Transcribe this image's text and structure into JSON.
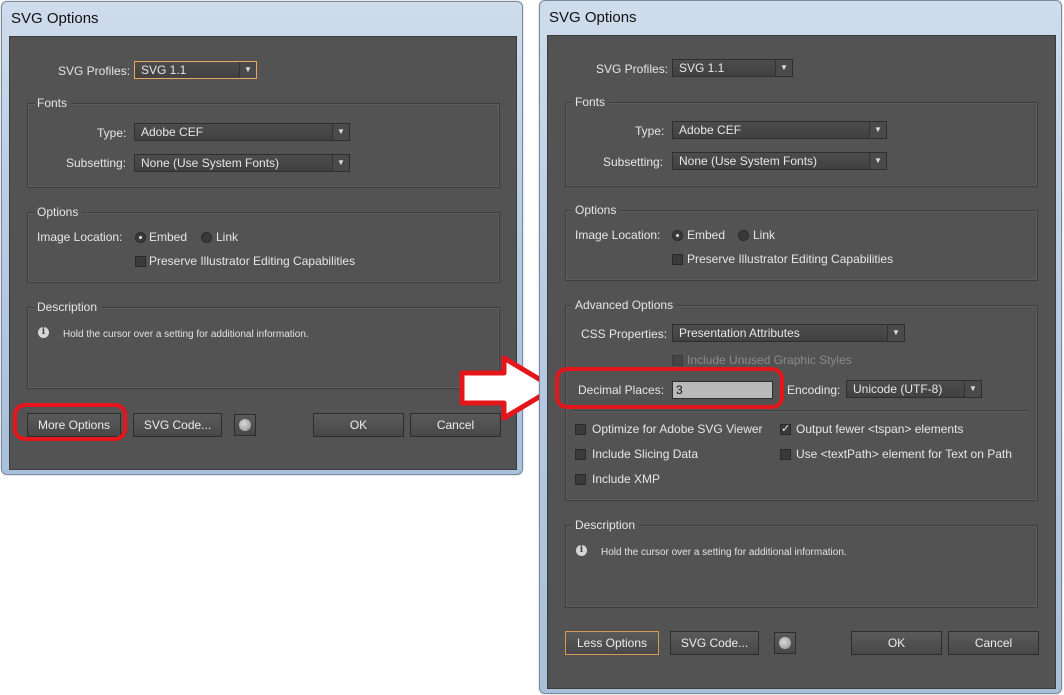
{
  "left": {
    "title": "SVG Options",
    "svg_profiles_label": "SVG Profiles:",
    "svg_profile_value": "SVG 1.1",
    "fonts_title": "Fonts",
    "type_label": "Type:",
    "type_value": "Adobe CEF",
    "subsetting_label": "Subsetting:",
    "subsetting_value": "None (Use System Fonts)",
    "options_title": "Options",
    "image_location_label": "Image Location:",
    "embed_label": "Embed",
    "link_label": "Link",
    "preserve_label": "Preserve Illustrator Editing Capabilities",
    "description_title": "Description",
    "description_text": "Hold the cursor over a setting for additional information.",
    "more_options_label": "More Options",
    "svg_code_label": "SVG Code...",
    "ok_label": "OK",
    "cancel_label": "Cancel"
  },
  "right": {
    "title": "SVG Options",
    "svg_profiles_label": "SVG Profiles:",
    "svg_profile_value": "SVG 1.1",
    "fonts_title": "Fonts",
    "type_label": "Type:",
    "type_value": "Adobe CEF",
    "subsetting_label": "Subsetting:",
    "subsetting_value": "None (Use System Fonts)",
    "options_title": "Options",
    "image_location_label": "Image Location:",
    "embed_label": "Embed",
    "link_label": "Link",
    "preserve_label": "Preserve Illustrator Editing Capabilities",
    "advanced_title": "Advanced Options",
    "css_properties_label": "CSS Properties:",
    "css_properties_value": "Presentation Attributes",
    "include_unused_label": "Include Unused Graphic Styles",
    "decimal_places_label": "Decimal Places:",
    "decimal_places_value": "3",
    "encoding_label": "Encoding:",
    "encoding_value": "Unicode (UTF-8)",
    "optimize_label": "Optimize for Adobe SVG Viewer",
    "output_fewer_label": "Output fewer <tspan> elements",
    "include_slicing_label": "Include Slicing Data",
    "use_textpath_label": "Use <textPath> element for Text on Path",
    "include_xmp_label": "Include XMP",
    "description_title": "Description",
    "description_text": "Hold the cursor over a setting for additional information.",
    "less_options_label": "Less Options",
    "svg_code_label": "SVG Code...",
    "ok_label": "OK",
    "cancel_label": "Cancel"
  },
  "colors": {
    "highlight_red": "#e4161b",
    "panel_bg": "#535353",
    "focus_orange": "#d69a55"
  },
  "icons": [
    "dropdown-arrow-icon",
    "radio-icon",
    "checkbox-icon",
    "info-icon",
    "globe-icon",
    "right-arrow-icon"
  ]
}
